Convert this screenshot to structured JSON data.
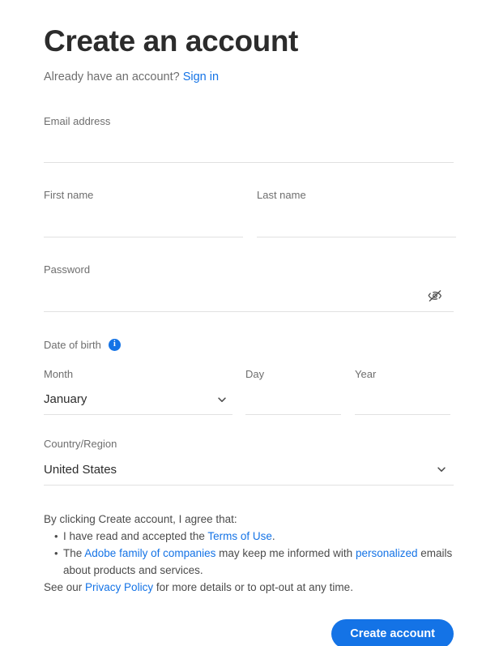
{
  "header": {
    "title": "Create an account",
    "already_have_account": "Already have an account?",
    "sign_in_label": "Sign in"
  },
  "form": {
    "email": {
      "label": "Email address",
      "value": "",
      "placeholder": ""
    },
    "first_name": {
      "label": "First name",
      "value": "",
      "placeholder": ""
    },
    "last_name": {
      "label": "Last name",
      "value": "",
      "placeholder": ""
    },
    "password": {
      "label": "Password",
      "value": "",
      "placeholder": "",
      "toggle_icon": "eye-off-icon"
    },
    "date_of_birth": {
      "label": "Date of birth",
      "info_icon": "info-icon",
      "info_glyph": "i",
      "month": {
        "label": "Month",
        "value": "January"
      },
      "day": {
        "label": "Day",
        "value": "",
        "placeholder": ""
      },
      "year": {
        "label": "Year",
        "value": "",
        "placeholder": ""
      }
    },
    "country": {
      "label": "Country/Region",
      "value": "United States"
    }
  },
  "legal": {
    "intro": "By clicking Create account, I agree that:",
    "bullet1_prefix": "I have read and accepted the ",
    "bullet1_link": "Terms of Use",
    "bullet1_suffix": ".",
    "bullet2_prefix": "The ",
    "bullet2_link1": "Adobe family of companies",
    "bullet2_mid": " may keep me informed with ",
    "bullet2_link2": "personalized",
    "bullet2_suffix": " emails about products and services.",
    "tail_prefix": "See our ",
    "tail_link": "Privacy Policy",
    "tail_suffix": " for more details or to opt-out at any time."
  },
  "submit": {
    "label": "Create account"
  },
  "colors": {
    "accent": "#1473e6",
    "heading": "#2c2c2c",
    "label": "#6e6e6e",
    "underline": "#e1e1e1",
    "body_text": "#4b4b4b"
  }
}
